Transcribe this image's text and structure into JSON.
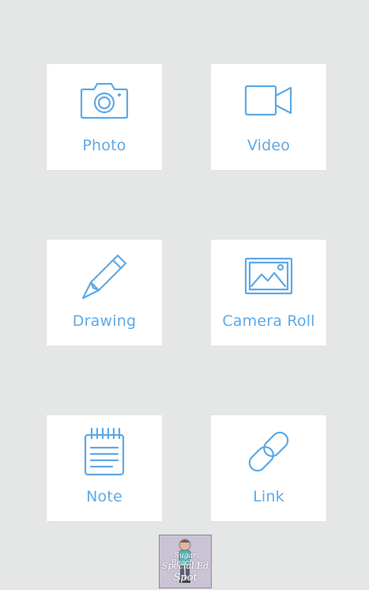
{
  "tiles": [
    {
      "id": "photo",
      "label": "Photo",
      "icon": "camera-icon"
    },
    {
      "id": "video",
      "label": "Video",
      "icon": "video-camera-icon"
    },
    {
      "id": "drawing",
      "label": "Drawing",
      "icon": "pencil-icon"
    },
    {
      "id": "camera_roll",
      "label": "Camera Roll",
      "icon": "image-icon"
    },
    {
      "id": "note",
      "label": "Note",
      "icon": "notepad-icon"
    },
    {
      "id": "link",
      "label": "Link",
      "icon": "chain-link-icon"
    }
  ],
  "watermark": {
    "line1": "Sugar Beach's",
    "line2": "Special Ed",
    "line3": "Spot"
  },
  "colors": {
    "background": "#e5e6e6",
    "tile": "#ffffff",
    "accent": "#5fa9e6"
  }
}
